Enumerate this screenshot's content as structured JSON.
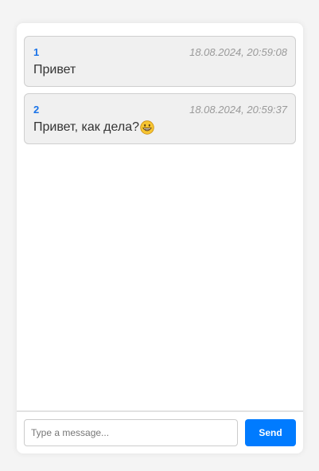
{
  "messages": [
    {
      "user": "1",
      "time": "18.08.2024, 20:59:08",
      "text": "Привет",
      "emoji": ""
    },
    {
      "user": "2",
      "time": "18.08.2024, 20:59:37",
      "text": "Привет, как дела?",
      "emoji": "grinning-face-icon"
    }
  ],
  "composer": {
    "placeholder": "Type a message...",
    "send_label": "Send"
  },
  "colors": {
    "accent": "#007bff",
    "username": "#1a73e8",
    "background": "#f4f4f4"
  }
}
